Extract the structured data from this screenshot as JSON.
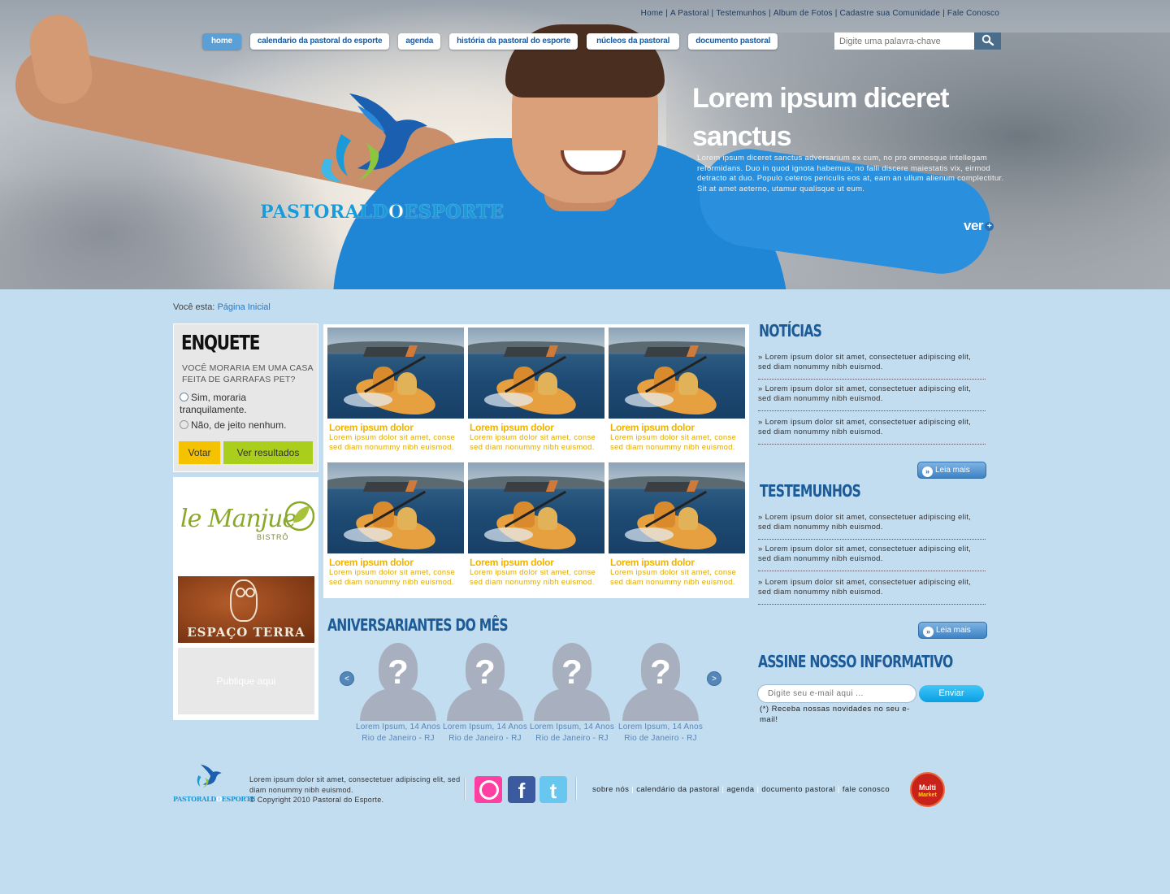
{
  "top_links": [
    "Home",
    "A Pastoral",
    "Testemunhos",
    "Album de Fotos",
    "Cadastre sua Comunidade",
    "Fale Conosco"
  ],
  "nav": {
    "home": "home",
    "calendario": "calendario da pastoral do esporte",
    "agenda": "agenda",
    "historia": "história da pastoral do esporte",
    "nucleos": "núcleos da pastoral",
    "documento": "documento pastoral"
  },
  "search": {
    "placeholder": "Digite uma palavra-chave"
  },
  "logo": {
    "part1": "PASTORALD",
    "part2": "O",
    "part3": "ESPORTE"
  },
  "hero": {
    "title": "Lorem ipsum diceret sanctus",
    "description": "Lorem ipsum diceret sanctus adversarium ex cum, no pro omnesque intellegam reformidans. Duo in quod ignota habemus, no falli discere maiestatis vix, eirmod detracto at duo. Populo ceteros periculis eos at, eam an ullum alienum complectitur. Sit at amet aeterno, utamur qualisque ut eum.",
    "more": "ver",
    "more_icon": "plus-circle-icon"
  },
  "breadcrumb": {
    "label": "Você esta:",
    "current": "Página Inicial"
  },
  "poll": {
    "title": "ENQUETE",
    "question": "VOCÊ MORARIA EM UMA CASA FEITA DE GARRAFAS PET?",
    "option1": "Sim, moraria tranquilamente.",
    "option2": "Não, de jeito nenhum.",
    "vote": "Votar",
    "results": "Ver resultados"
  },
  "ads": {
    "manjue_name": "le Manjue",
    "manjue_sub": "BISTRÔ",
    "terra": "ESPAÇO TERRA",
    "publique": "Publique aqui"
  },
  "gallery": [
    {
      "title": "Lorem ipsum dolor",
      "text": "Lorem ipsum dolor sit amet, conse sed diam nonummy nibh euismod."
    },
    {
      "title": "Lorem ipsum dolor",
      "text": "Lorem ipsum dolor sit amet, conse sed diam nonummy nibh euismod."
    },
    {
      "title": "Lorem ipsum dolor",
      "text": "Lorem ipsum dolor sit amet, conse sed diam nonummy nibh euismod."
    },
    {
      "title": "Lorem ipsum dolor",
      "text": "Lorem ipsum dolor sit amet, conse sed diam nonummy nibh euismod."
    },
    {
      "title": "Lorem ipsum dolor",
      "text": "Lorem ipsum dolor sit amet, conse sed diam nonummy nibh euismod."
    },
    {
      "title": "Lorem ipsum dolor",
      "text": "Lorem ipsum dolor sit amet, conse sed diam nonummy nibh euismod."
    }
  ],
  "birthdays": {
    "title": "ANIVERSARIANTES DO MÊS",
    "prev": "<",
    "next": ">",
    "people": [
      {
        "name": "Lorem Ipsum, 14 Anos",
        "place": "Rio de Janeiro - RJ"
      },
      {
        "name": "Lorem Ipsum, 14 Anos",
        "place": "Rio de Janeiro - RJ"
      },
      {
        "name": "Lorem Ipsum, 14 Anos",
        "place": "Rio de Janeiro - RJ"
      },
      {
        "name": "Lorem Ipsum, 14 Anos",
        "place": "Rio de Janeiro - RJ"
      }
    ]
  },
  "news": {
    "title": "NOTÍCIAS",
    "items": [
      "Lorem ipsum dolor sit amet, consectetuer adipiscing elit, sed diam nonummy nibh euismod.",
      "Lorem ipsum dolor sit amet, consectetuer adipiscing elit, sed diam nonummy nibh euismod.",
      "Lorem ipsum dolor sit amet, consectetuer adipiscing elit, sed diam nonummy nibh euismod."
    ],
    "more": "Leia mais"
  },
  "testimonials": {
    "title": "TESTEMUNHOS",
    "items": [
      "Lorem ipsum dolor sit amet, consectetuer adipiscing elit, sed diam nonummy nibh euismod.",
      "Lorem ipsum dolor sit amet, consectetuer adipiscing elit, sed diam nonummy nibh euismod.",
      "Lorem ipsum dolor sit amet, consectetuer adipiscing elit, sed diam nonummy nibh euismod."
    ],
    "more": "Leia mais"
  },
  "newsletter": {
    "title": "ASSINE NOSSO INFORMATIVO",
    "placeholder": "Digite seu e-mail aqui ...",
    "button": "Enviar",
    "note": "(*) Receba nossas novidades no seu e-mail!"
  },
  "footer": {
    "logo_text1": "PASTORALD",
    "logo_text2": "O",
    "logo_text3": "ESPORTE",
    "text1": "Lorem ipsum dolor sit amet, consectetuer adipiscing elit, sed diam nonummy nibh euismod.",
    "copyright": "© Copyright 2010 Pastoral do Esporte.",
    "social_facebook": "f",
    "social_twitter": "t",
    "links": [
      "sobre nós",
      "calendário da pastoral",
      "agenda",
      "documento pastoral",
      "fale conosco"
    ],
    "sponsor_line1": "Multi",
    "sponsor_line2": "Market"
  },
  "colors": {
    "page_bg": "#c3ddf0",
    "heading_blue": "#1c5b97",
    "gallery_caption": "#f0b400",
    "vote_yellow": "#f5c200",
    "results_green": "#a9cf1c",
    "nav_active": "#5b9fd7"
  }
}
